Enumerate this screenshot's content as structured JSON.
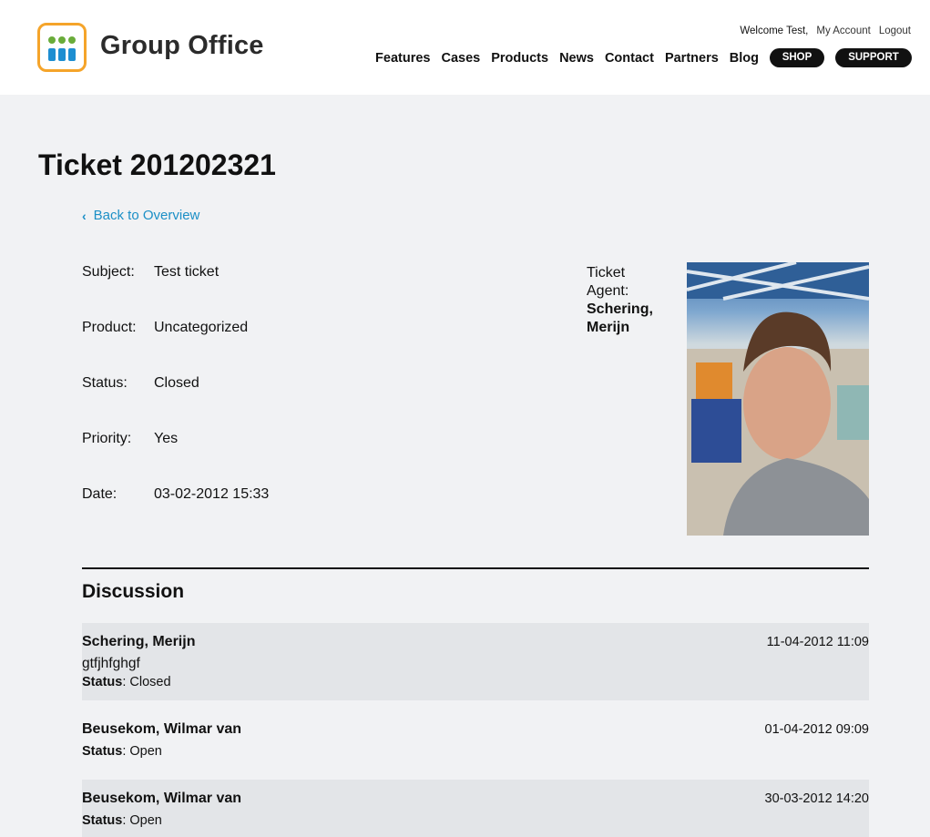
{
  "brand": {
    "name": "Group Office",
    "logo_icon": "group-office-logo",
    "accent": "#f5a42a"
  },
  "header": {
    "welcome": "Welcome Test,",
    "links": {
      "account": "My Account",
      "logout": "Logout"
    },
    "nav": [
      "Features",
      "Cases",
      "Products",
      "News",
      "Contact",
      "Partners",
      "Blog"
    ],
    "shop": "SHOP",
    "support": "SUPPORT"
  },
  "ticket": {
    "title": "Ticket 201202321",
    "back_label": "Back to Overview",
    "fields": [
      {
        "label": "Subject:",
        "value": "Test ticket"
      },
      {
        "label": "Product:",
        "value": "Uncategorized"
      },
      {
        "label": "Status:",
        "value": "Closed"
      },
      {
        "label": "Priority:",
        "value": "Yes"
      },
      {
        "label": "Date:",
        "value": "03-02-2012 15:33"
      }
    ],
    "agent_label_1": "Ticket",
    "agent_label_2": "Agent:",
    "agent_name_1": "Schering,",
    "agent_name_2": "Merijn"
  },
  "discussion": {
    "title": "Discussion",
    "status_label": "Status",
    "messages": [
      {
        "author": "Schering, Merijn",
        "date": "11-04-2012 11:09",
        "body": "gtfjhfghgf",
        "status": "Closed"
      },
      {
        "author": "Beusekom, Wilmar van",
        "date": "01-04-2012 09:09",
        "body": "",
        "status": "Open"
      },
      {
        "author": "Beusekom, Wilmar van",
        "date": "30-03-2012 14:20",
        "body": "",
        "status": "Open"
      }
    ]
  }
}
